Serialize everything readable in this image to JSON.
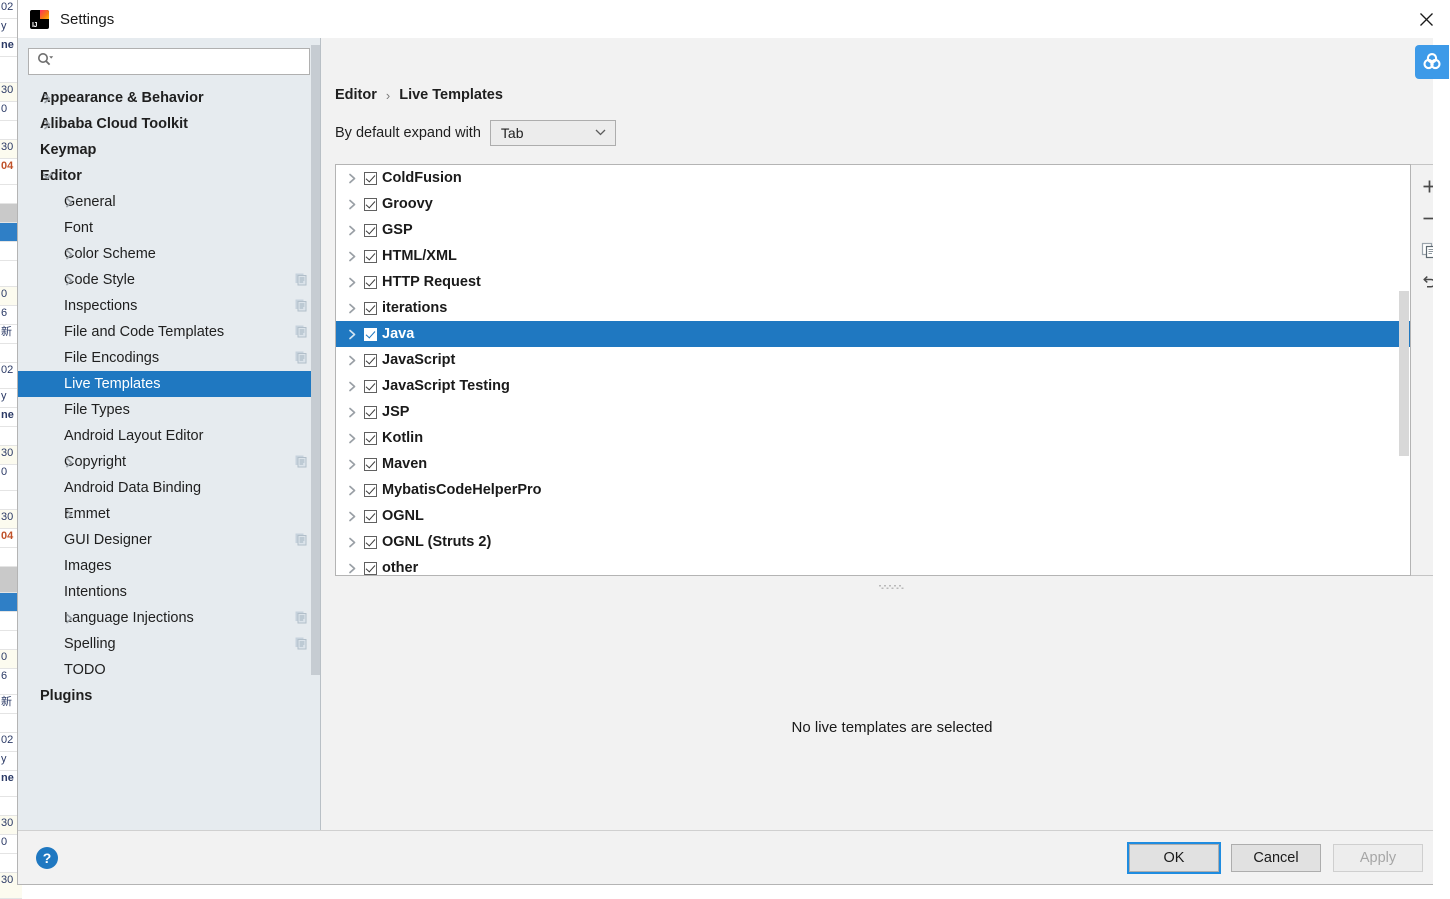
{
  "window": {
    "title": "Settings",
    "logo_icon": "intellij-idea-logo",
    "close_icon": "close-icon"
  },
  "sidebar": {
    "search": {
      "placeholder": "",
      "value": "",
      "icon": "search-icon",
      "dropdown_icon": "chevron-down-icon"
    },
    "items": [
      {
        "label": "Appearance & Behavior",
        "level": 0,
        "arrow": "collapsed",
        "bold": true,
        "copy": false,
        "selected": false
      },
      {
        "label": "Alibaba Cloud Toolkit",
        "level": 0,
        "arrow": "collapsed",
        "bold": true,
        "copy": false,
        "selected": false
      },
      {
        "label": "Keymap",
        "level": 0,
        "arrow": "none",
        "bold": true,
        "copy": false,
        "selected": false
      },
      {
        "label": "Editor",
        "level": 0,
        "arrow": "expanded",
        "bold": true,
        "copy": false,
        "selected": false
      },
      {
        "label": "General",
        "level": 1,
        "arrow": "collapsed",
        "bold": false,
        "copy": false,
        "selected": false
      },
      {
        "label": "Font",
        "level": 1,
        "arrow": "none",
        "bold": false,
        "copy": false,
        "selected": false
      },
      {
        "label": "Color Scheme",
        "level": 1,
        "arrow": "collapsed",
        "bold": false,
        "copy": false,
        "selected": false
      },
      {
        "label": "Code Style",
        "level": 1,
        "arrow": "collapsed",
        "bold": false,
        "copy": true,
        "selected": false
      },
      {
        "label": "Inspections",
        "level": 1,
        "arrow": "none",
        "bold": false,
        "copy": true,
        "selected": false
      },
      {
        "label": "File and Code Templates",
        "level": 1,
        "arrow": "none",
        "bold": false,
        "copy": true,
        "selected": false
      },
      {
        "label": "File Encodings",
        "level": 1,
        "arrow": "none",
        "bold": false,
        "copy": true,
        "selected": false
      },
      {
        "label": "Live Templates",
        "level": 1,
        "arrow": "none",
        "bold": false,
        "copy": false,
        "selected": true
      },
      {
        "label": "File Types",
        "level": 1,
        "arrow": "none",
        "bold": false,
        "copy": false,
        "selected": false
      },
      {
        "label": "Android Layout Editor",
        "level": 1,
        "arrow": "none",
        "bold": false,
        "copy": false,
        "selected": false
      },
      {
        "label": "Copyright",
        "level": 1,
        "arrow": "collapsed",
        "bold": false,
        "copy": true,
        "selected": false
      },
      {
        "label": "Android Data Binding",
        "level": 1,
        "arrow": "none",
        "bold": false,
        "copy": false,
        "selected": false
      },
      {
        "label": "Emmet",
        "level": 1,
        "arrow": "collapsed",
        "bold": false,
        "copy": false,
        "selected": false
      },
      {
        "label": "GUI Designer",
        "level": 1,
        "arrow": "none",
        "bold": false,
        "copy": true,
        "selected": false
      },
      {
        "label": "Images",
        "level": 1,
        "arrow": "none",
        "bold": false,
        "copy": false,
        "selected": false
      },
      {
        "label": "Intentions",
        "level": 1,
        "arrow": "none",
        "bold": false,
        "copy": false,
        "selected": false
      },
      {
        "label": "Language Injections",
        "level": 1,
        "arrow": "collapsed",
        "bold": false,
        "copy": true,
        "selected": false
      },
      {
        "label": "Spelling",
        "level": 1,
        "arrow": "none",
        "bold": false,
        "copy": true,
        "selected": false
      },
      {
        "label": "TODO",
        "level": 1,
        "arrow": "none",
        "bold": false,
        "copy": false,
        "selected": false
      },
      {
        "label": "Plugins",
        "level": 0,
        "arrow": "none",
        "bold": true,
        "copy": false,
        "selected": false
      }
    ]
  },
  "main": {
    "breadcrumb": {
      "parent": "Editor",
      "separator": "›",
      "current": "Live Templates"
    },
    "expand_with": {
      "label": "By default expand with",
      "value": "Tab",
      "chevron_icon": "chevron-down-icon"
    },
    "templates": [
      {
        "label": "ColdFusion",
        "checked": true,
        "selected": false
      },
      {
        "label": "Groovy",
        "checked": true,
        "selected": false
      },
      {
        "label": "GSP",
        "checked": true,
        "selected": false
      },
      {
        "label": "HTML/XML",
        "checked": true,
        "selected": false
      },
      {
        "label": "HTTP Request",
        "checked": true,
        "selected": false
      },
      {
        "label": "iterations",
        "checked": true,
        "selected": false
      },
      {
        "label": "Java",
        "checked": true,
        "selected": true
      },
      {
        "label": "JavaScript",
        "checked": true,
        "selected": false
      },
      {
        "label": "JavaScript Testing",
        "checked": true,
        "selected": false
      },
      {
        "label": "JSP",
        "checked": true,
        "selected": false
      },
      {
        "label": "Kotlin",
        "checked": true,
        "selected": false
      },
      {
        "label": "Maven",
        "checked": true,
        "selected": false
      },
      {
        "label": "MybatisCodeHelperPro",
        "checked": true,
        "selected": false
      },
      {
        "label": "OGNL",
        "checked": true,
        "selected": false
      },
      {
        "label": "OGNL (Struts 2)",
        "checked": true,
        "selected": false
      },
      {
        "label": "other",
        "checked": true,
        "selected": false
      }
    ],
    "toolbar": [
      {
        "name": "add-template-button",
        "icon": "plus-icon"
      },
      {
        "name": "remove-template-button",
        "icon": "minus-icon"
      },
      {
        "name": "duplicate-template-button",
        "icon": "copy-icon"
      },
      {
        "name": "revert-template-button",
        "icon": "undo-icon"
      }
    ],
    "preview_message": "No live templates are selected"
  },
  "footer": {
    "help_icon": "question-mark-icon",
    "ok_label": "OK",
    "cancel_label": "Cancel",
    "apply_label": "Apply"
  },
  "overlay": {
    "badge_icon": "loop-rings-icon"
  },
  "colors": {
    "accent_blue": "#1f78c1",
    "badge_blue": "#3d9ae8",
    "dialog_bg": "#f2f2f2",
    "sidebar_bg": "#e6ebef",
    "list_bg": "#ffffff"
  }
}
